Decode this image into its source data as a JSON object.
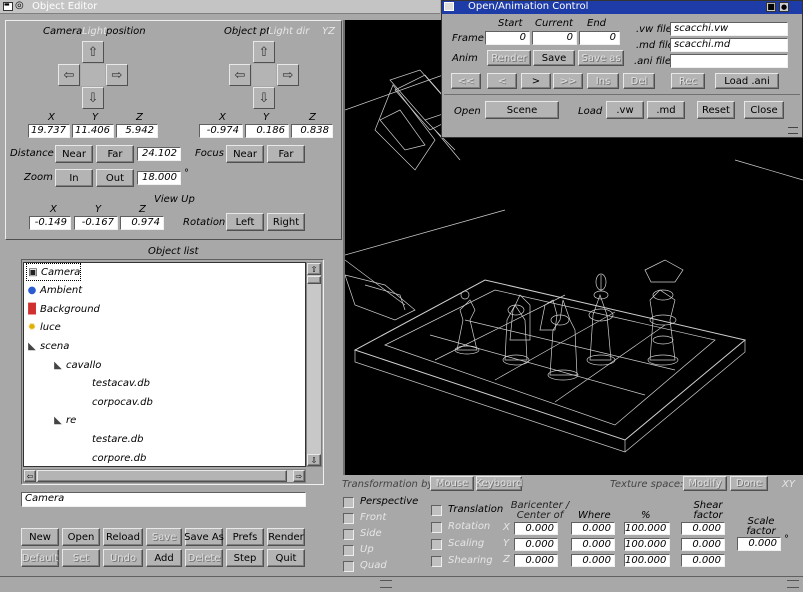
{
  "object_editor": {
    "title": "Object Editor",
    "camera_group": {
      "label_1": "Camera",
      "label_2": "Light",
      "label_3": "position"
    },
    "object_group": {
      "label_1": "Object pt",
      "label_2": "Light dir"
    },
    "plane_label": "YZ",
    "xyz": {
      "x": "X",
      "y": "Y",
      "z": "Z"
    },
    "camera_pos": {
      "x": "19.737",
      "y": "11.406",
      "z": "5.942"
    },
    "object_pt": {
      "x": "-0.974",
      "y": "0.186",
      "z": "0.838"
    },
    "distance": {
      "label": "Distance",
      "near": "Near",
      "far": "Far",
      "value": "24.102"
    },
    "focus": {
      "label": "Focus",
      "near": "Near",
      "far": "Far"
    },
    "zoom": {
      "label": "Zoom",
      "in": "In",
      "out": "Out",
      "value": "18.000",
      "unit": "°"
    },
    "view_up": {
      "label": "View Up",
      "x": "-0.149",
      "y": "-0.167",
      "z": "0.974"
    },
    "rotation": {
      "label": "Rotation",
      "left": "Left",
      "right": "Right"
    },
    "object_list_label": "Object list",
    "objects": [
      {
        "name": "Camera",
        "icon": "camera-icon",
        "indent": 0,
        "selected": true
      },
      {
        "name": "Ambient",
        "icon": "globe-icon",
        "indent": 0
      },
      {
        "name": "Background",
        "icon": "rainbow-icon",
        "indent": 0
      },
      {
        "name": "luce",
        "icon": "light-icon",
        "indent": 0
      },
      {
        "name": "scena",
        "icon": "group-icon",
        "indent": 0
      },
      {
        "name": "cavallo",
        "icon": "group-icon",
        "indent": 1
      },
      {
        "name": "testacav.db",
        "icon": "",
        "indent": 2
      },
      {
        "name": "corpocav.db",
        "icon": "",
        "indent": 2
      },
      {
        "name": "re",
        "icon": "group-icon",
        "indent": 1
      },
      {
        "name": "testare.db",
        "icon": "",
        "indent": 2
      },
      {
        "name": "corpore.db",
        "icon": "",
        "indent": 2
      }
    ],
    "selected_object": "Camera",
    "buttons_row1": [
      {
        "label": "New",
        "disabled": false
      },
      {
        "label": "Open",
        "disabled": false
      },
      {
        "label": "Reload",
        "disabled": false
      },
      {
        "label": "Save",
        "disabled": true
      },
      {
        "label": "Save As",
        "disabled": false
      },
      {
        "label": "Prefs",
        "disabled": false
      },
      {
        "label": "Render",
        "disabled": false
      }
    ],
    "buttons_row2": [
      {
        "label": "Default",
        "disabled": true
      },
      {
        "label": "Set",
        "disabled": true
      },
      {
        "label": "Undo",
        "disabled": true
      },
      {
        "label": "Add",
        "disabled": false
      },
      {
        "label": "Delete",
        "disabled": true
      },
      {
        "label": "Step",
        "disabled": false
      },
      {
        "label": "Quit",
        "disabled": false
      }
    ]
  },
  "anim": {
    "title": "Open/Animation Control",
    "start_label": "Start",
    "current_label": "Current",
    "end_label": "End",
    "frame_label": "Frame",
    "start": "0",
    "current": "0",
    "end": "0",
    "anim_label": "Anim",
    "render": "Render",
    "save": "Save",
    "save_as": "Save as",
    "nav": [
      "<<",
      "<",
      ">",
      ">>"
    ],
    "nav_disabled": [
      true,
      true,
      false,
      true
    ],
    "ins": "Ins",
    "del": "Del",
    "rec": "Rec",
    "load_ani": "Load .ani",
    "vw_label": ".vw file",
    "vw_file": "scacchi.vw",
    "md_label": ".md file",
    "md_file": "scacchi.md",
    "ani_label": ".ani file",
    "ani_file": "",
    "open_label": "Open",
    "scene": "Scene",
    "load_label": "Load",
    "vw_btn": ".vw",
    "md_btn": ".md",
    "reset": "Reset",
    "close": "Close"
  },
  "transform": {
    "by_label": "Transformation by:",
    "mouse": "Mouse",
    "keyboard": "Keyboard",
    "texture_label": "Texture space:",
    "modify": "Modify",
    "done": "Done",
    "plane": "XY",
    "views": [
      "Perspective",
      "Front",
      "Side",
      "Up",
      "Quad"
    ],
    "ops": [
      "Translation",
      "Rotation",
      "Scaling",
      "Shearing"
    ],
    "bary_label": "Baricenter / Center of",
    "where_label": "Where",
    "pct_label": "%",
    "shear_label": "Shear factor",
    "scale_label": "Scale factor",
    "axes": [
      "X",
      "Y",
      "Z"
    ],
    "bary": [
      "0.000",
      "0.000",
      "0.000"
    ],
    "where": [
      "0.000",
      "0.000",
      "0.000"
    ],
    "pct": [
      "100.000",
      "100.000",
      "100.000"
    ],
    "shear": [
      "0.000",
      "0.000",
      "0.000"
    ],
    "scale": "0.000",
    "scale_unit": "°"
  },
  "colors": {
    "viewport_bg": "#000000",
    "wire": "#ffffff",
    "panel": "#a8a8a8"
  }
}
